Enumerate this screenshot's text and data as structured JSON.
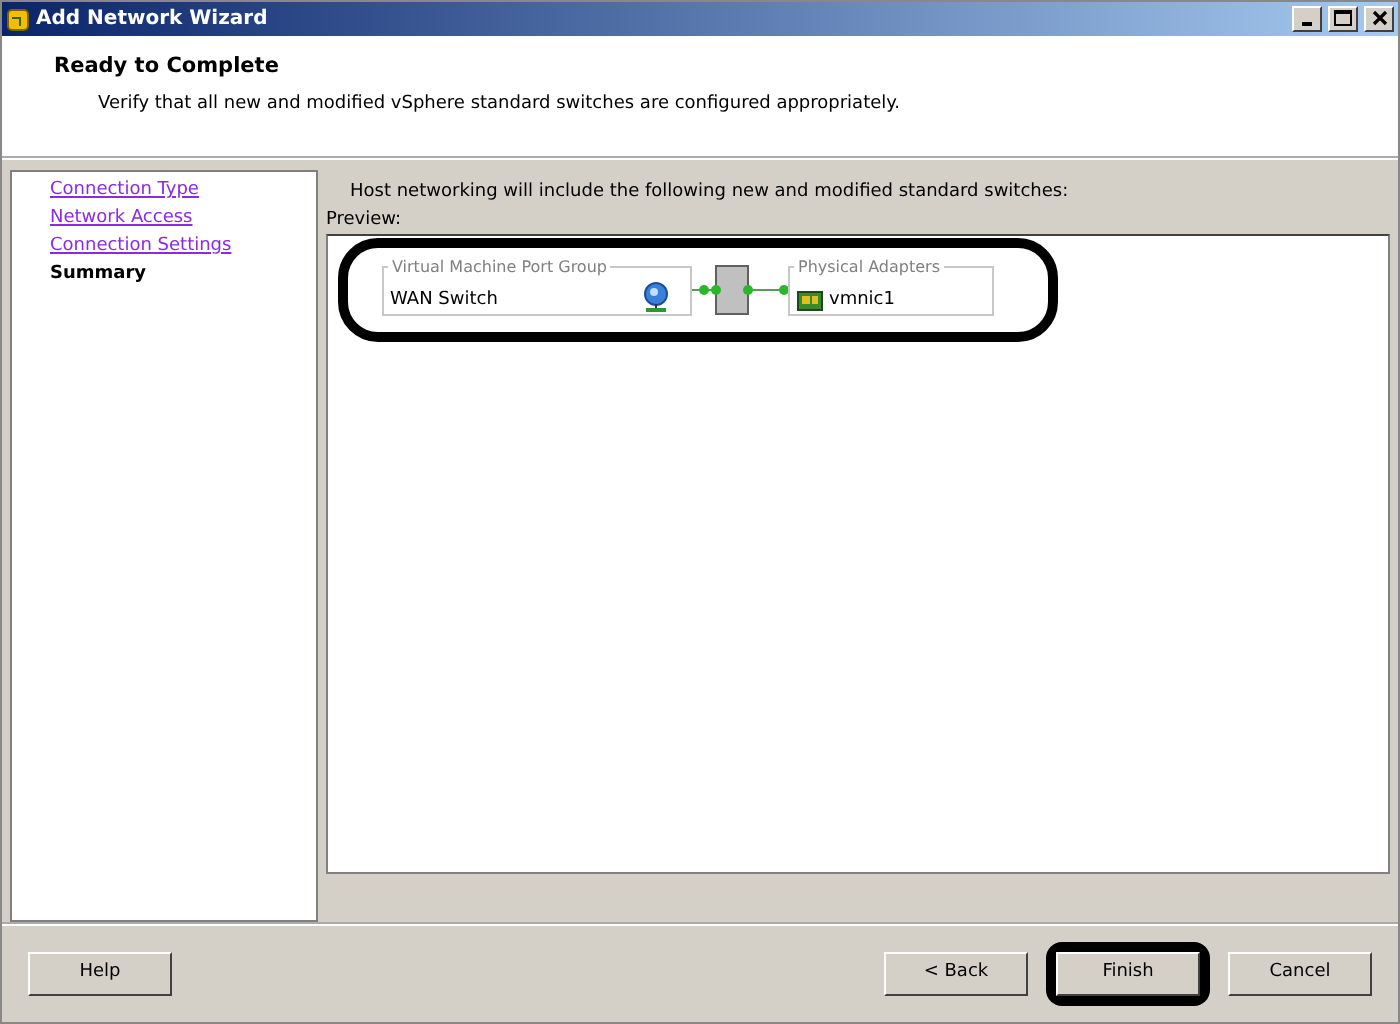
{
  "window": {
    "title": "Add Network Wizard"
  },
  "header": {
    "title": "Ready to Complete",
    "subtitle": "Verify that all new and modified vSphere standard switches are configured appropriately."
  },
  "steps": [
    {
      "label": "Connection Type",
      "selected": false
    },
    {
      "label": "Network Access",
      "selected": false
    },
    {
      "label": "Connection Settings",
      "selected": false
    },
    {
      "label": "Summary",
      "selected": true
    }
  ],
  "intro": "Host networking will include the following new and modified standard switches:",
  "preview": {
    "label": "Preview:",
    "highlighted": true,
    "port_group": {
      "title": "Virtual Machine Port Group",
      "name": "WAN Switch"
    },
    "adapters": {
      "title": "Physical Adapters",
      "name": "vmnic1"
    }
  },
  "buttons": [
    {
      "label": "Help",
      "kind": "left",
      "highlighted": false
    },
    {
      "label": "< Back",
      "kind": "right",
      "highlighted": false
    },
    {
      "label": "Finish",
      "kind": "right",
      "highlighted": true
    },
    {
      "label": "Cancel",
      "kind": "right",
      "highlighted": false
    }
  ]
}
